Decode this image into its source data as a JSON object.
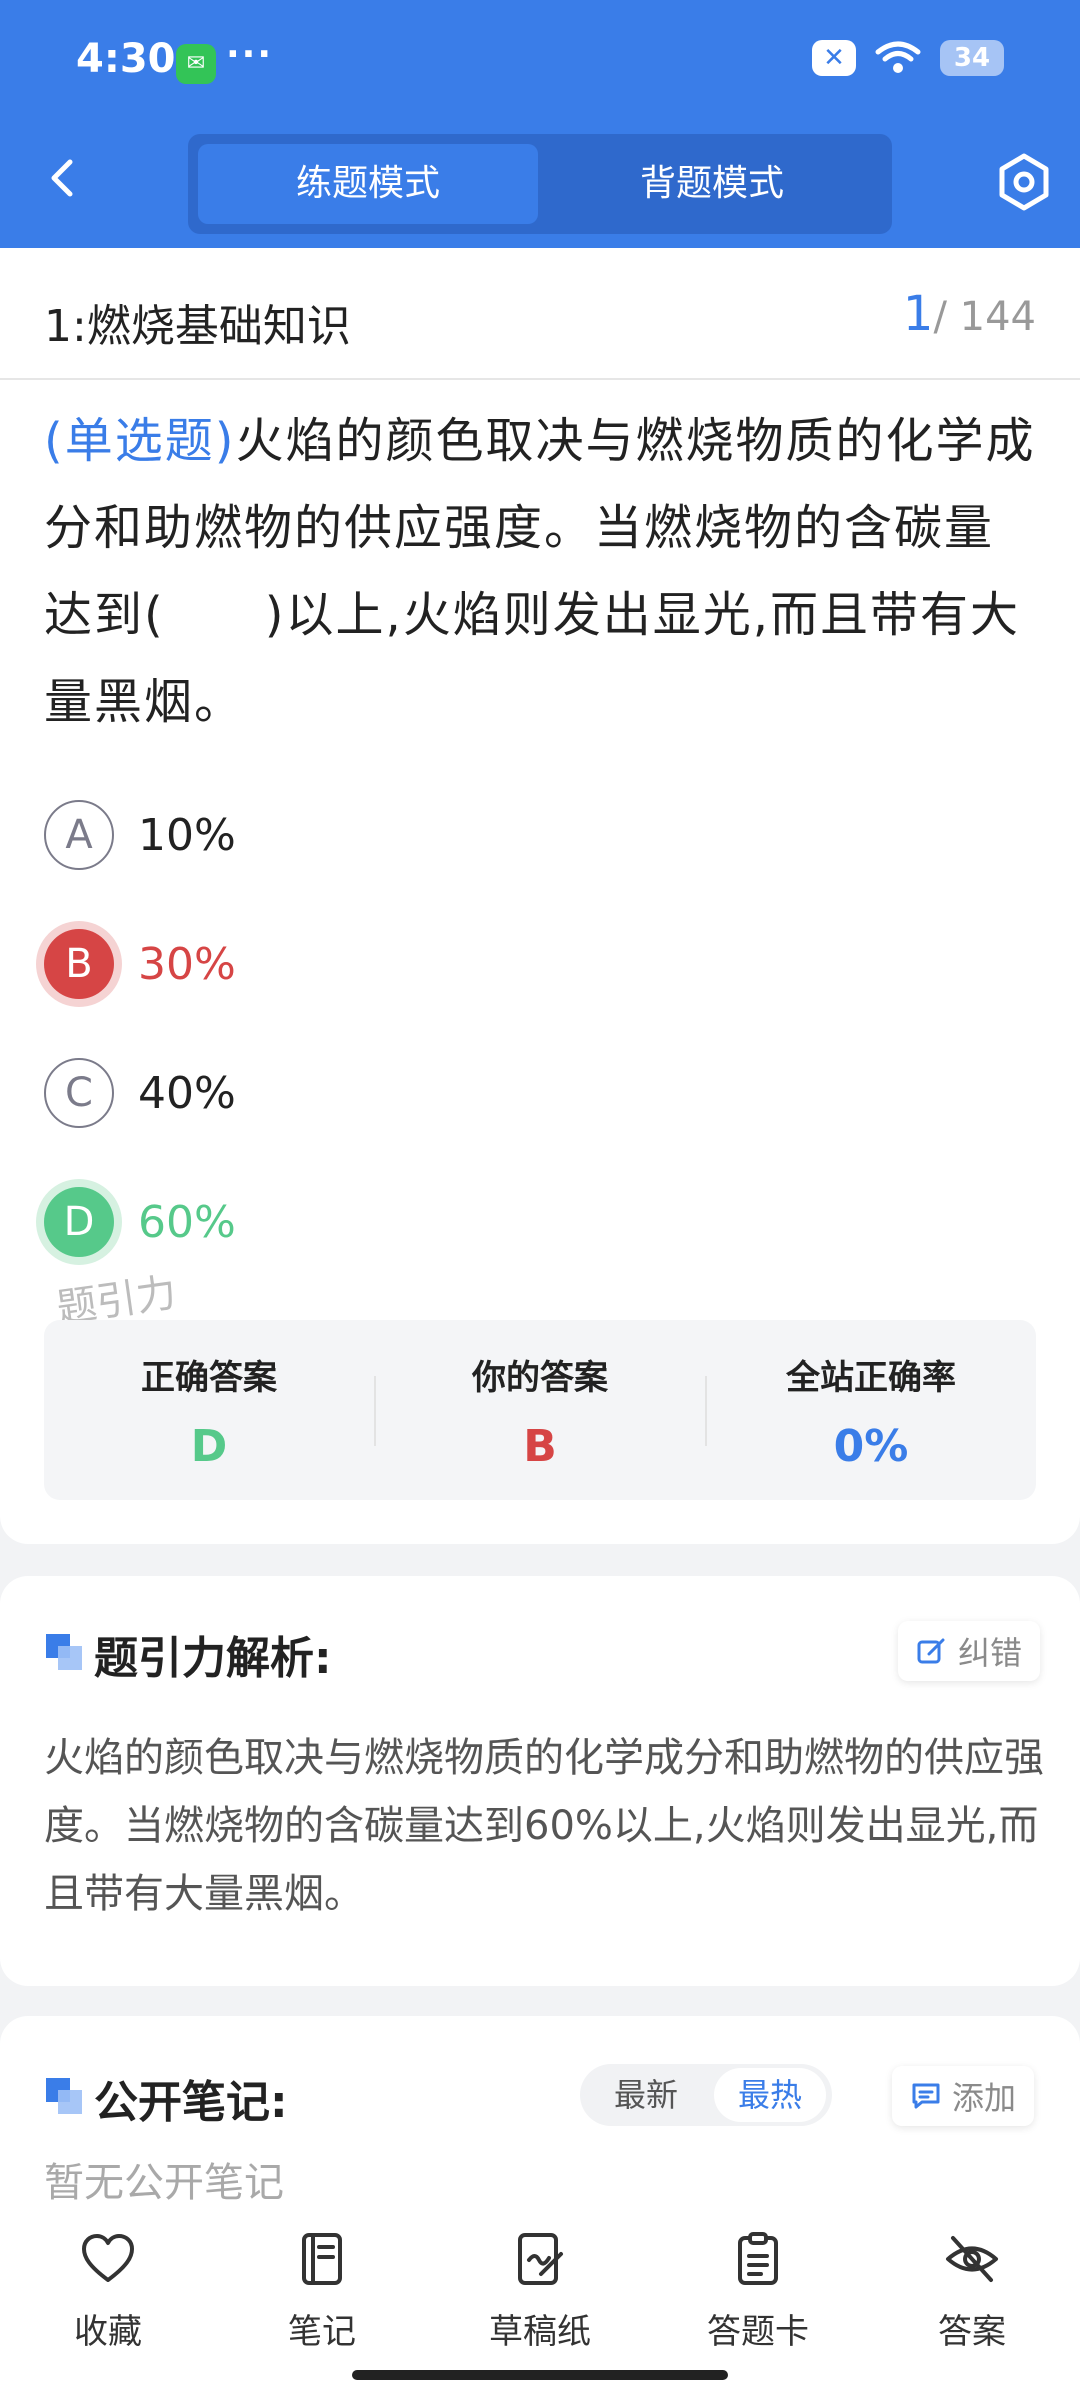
{
  "status_bar": {
    "time": "4:30",
    "more": "···",
    "battery": "34"
  },
  "header": {
    "tabs": [
      {
        "label": "练题模式",
        "active": true
      },
      {
        "label": "背题模式",
        "active": false
      }
    ]
  },
  "section": {
    "title": "1:燃烧基础知识",
    "current": "1",
    "total": "/ 144"
  },
  "question": {
    "type_tag": "(单选题)",
    "text": "火焰的颜色取决与燃烧物质的化学成分和助燃物的供应强度。当燃烧物的含碳量达到(　　)以上,火焰则发出显光,而且带有大量黑烟。"
  },
  "options": [
    {
      "letter": "A",
      "text": "10%",
      "state": "normal"
    },
    {
      "letter": "B",
      "text": "30%",
      "state": "wrong"
    },
    {
      "letter": "C",
      "text": "40%",
      "state": "normal"
    },
    {
      "letter": "D",
      "text": "60%",
      "state": "correct"
    }
  ],
  "watermark": "题引力",
  "stats": {
    "correct_label": "正确答案",
    "correct_value": "D",
    "yours_label": "你的答案",
    "yours_value": "B",
    "rate_label": "全站正确率",
    "rate_value": "0%"
  },
  "analysis": {
    "title": "题引力解析:",
    "report_label": "纠错",
    "text": "火焰的颜色取决与燃烧物质的化学成分和助燃物的供应强度。当燃烧物的含碳量达到60%以上,火焰则发出显光,而且带有大量黑烟。"
  },
  "notes": {
    "title": "公开笔记:",
    "sort_latest": "最新",
    "sort_hot": "最热",
    "add_label": "添加",
    "empty_text": "暂无公开笔记"
  },
  "bottom_nav": [
    {
      "label": "收藏",
      "icon": "heart-icon"
    },
    {
      "label": "笔记",
      "icon": "notebook-icon"
    },
    {
      "label": "草稿纸",
      "icon": "draft-icon"
    },
    {
      "label": "答题卡",
      "icon": "answer-card-icon"
    },
    {
      "label": "答案",
      "icon": "eye-off-icon"
    }
  ],
  "colors": {
    "primary": "#3a7de8",
    "wrong": "#d64545",
    "correct": "#56c98a"
  }
}
